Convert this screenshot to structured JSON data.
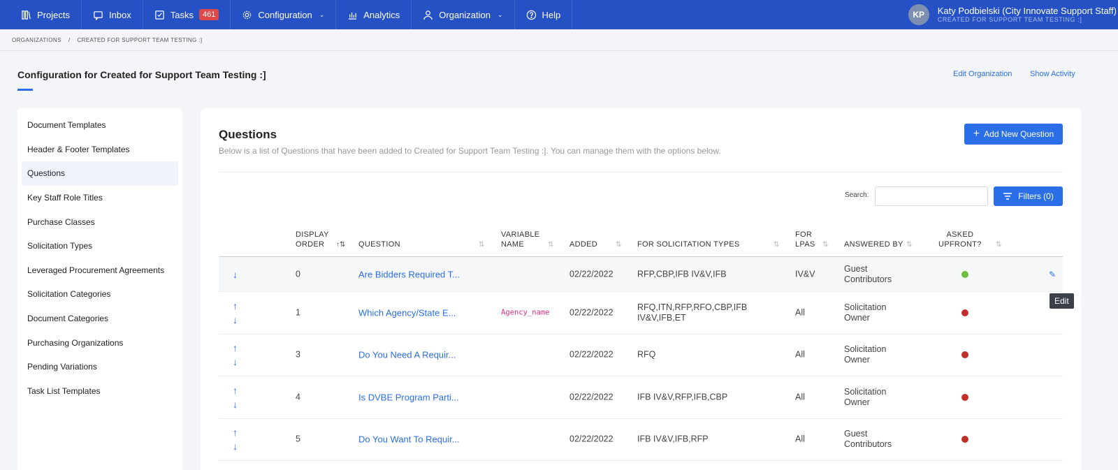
{
  "nav": {
    "items": [
      {
        "label": "Projects",
        "icon": "projects-icon"
      },
      {
        "label": "Inbox",
        "icon": "inbox-icon"
      },
      {
        "label": "Tasks",
        "icon": "tasks-icon",
        "badge": "461"
      },
      {
        "label": "Configuration",
        "icon": "gear-icon",
        "dropdown": true
      },
      {
        "label": "Analytics",
        "icon": "analytics-icon"
      },
      {
        "label": "Organization",
        "icon": "organization-icon",
        "dropdown": true
      },
      {
        "label": "Help",
        "icon": "help-icon"
      }
    ],
    "user": {
      "initials": "KP",
      "name": "Katy Podbielski (City Innovate Support Staff)",
      "org": "CREATED FOR SUPPORT TEAM TESTING :]"
    }
  },
  "breadcrumb": [
    "ORGANIZATIONS",
    "/",
    "CREATED FOR SUPPORT TEAM TESTING :]"
  ],
  "page": {
    "title": "Configuration for Created for Support Team Testing :]",
    "edit_org": "Edit Organization",
    "show_activity": "Show Activity"
  },
  "sidebar": {
    "items": [
      "Document Templates",
      "Header & Footer Templates",
      "Questions",
      "Key Staff Role Titles",
      "Purchase Classes",
      "Solicitation Types",
      "Leveraged Procurement Agreements",
      "Solicitation Categories",
      "Document Categories",
      "Purchasing Organizations",
      "Pending Variations",
      "Task List Templates"
    ],
    "active_index": 2
  },
  "questions": {
    "title": "Questions",
    "subtitle": "Below is a list of Questions that have been added to Created for Support Team Testing :]. You can manage them with the options below.",
    "add_button": "Add New Question",
    "search_label": "Search:",
    "search_value": "",
    "filters_button": "Filters (0)",
    "columns": {
      "display_order_1": "DISPLAY",
      "display_order_2": "ORDER",
      "question": "QUESTION",
      "variable_1": "VARIABLE",
      "variable_2": "NAME",
      "added": "ADDED",
      "solicitation": "FOR SOLICITATION TYPES",
      "lpas_1": "FOR",
      "lpas_2": "LPAS",
      "answered_by": "ANSWERED BY",
      "upfront_1": "ASKED",
      "upfront_2": "UPFRONT?"
    },
    "rows": [
      {
        "order": "0",
        "question": "Are Bidders Required T...",
        "variable": "",
        "added": "02/22/2022",
        "types": "RFP,CBP,IFB IV&V,IFB",
        "lpas": "IV&V",
        "answered_by": "Guest Contributors",
        "upfront": true,
        "up": false,
        "down": true
      },
      {
        "order": "1",
        "question": "Which Agency/State E...",
        "variable": "Agency_name",
        "added": "02/22/2022",
        "types": "RFQ,ITN,RFP,RFO,CBP,IFB IV&V,IFB,ET",
        "lpas": "All",
        "answered_by": "Solicitation Owner",
        "upfront": false,
        "up": true,
        "down": true
      },
      {
        "order": "3",
        "question": "Do You Need A Requir...",
        "variable": "",
        "added": "02/22/2022",
        "types": "RFQ",
        "lpas": "All",
        "answered_by": "Solicitation Owner",
        "upfront": false,
        "up": true,
        "down": true
      },
      {
        "order": "4",
        "question": "Is DVBE Program Parti...",
        "variable": "",
        "added": "02/22/2022",
        "types": "IFB IV&V,RFP,IFB,CBP",
        "lpas": "All",
        "answered_by": "Solicitation Owner",
        "upfront": false,
        "up": true,
        "down": true
      },
      {
        "order": "5",
        "question": "Do You Want To Requir...",
        "variable": "",
        "added": "02/22/2022",
        "types": "IFB IV&V,IFB,RFP",
        "lpas": "All",
        "answered_by": "Guest Contributors",
        "upfront": false,
        "up": true,
        "down": true
      }
    ],
    "tooltip": "Edit"
  },
  "colors": {
    "nav_bg": "#2651c5",
    "accent": "#2a6ee8",
    "status_yes": "#6cbf3f",
    "status_no": "#c0302b",
    "badge": "#e04848"
  }
}
